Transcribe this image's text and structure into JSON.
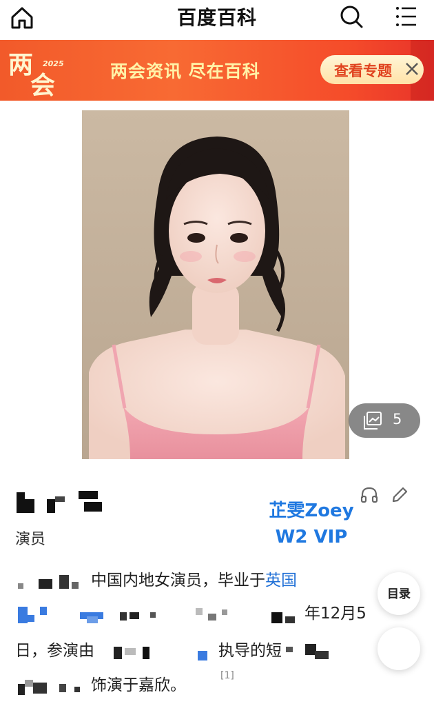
{
  "header": {
    "title": "百度百科",
    "home_icon": "home-icon",
    "search_icon": "search-icon",
    "menu_icon": "menu-icon"
  },
  "banner": {
    "logo_text": "两会",
    "logo_year": "2025",
    "slogan": "两会资讯 尽在百科",
    "cta_label": "查看专题",
    "close_icon": "close-icon",
    "colors": {
      "background": "#f25a2a",
      "slogan": "#fff3a8",
      "cta_text": "#e0431f"
    }
  },
  "photo": {
    "gallery_icon": "gallery-icon",
    "gallery_count": "5"
  },
  "entry": {
    "role": "演员",
    "audio_icon": "headphones-icon",
    "edit_icon": "pencil-icon",
    "watermark_line1": "芷雯Zoey",
    "watermark_line2": "W2 VIP",
    "watermark_color": "#1f78e0"
  },
  "summary": {
    "line1_text": "中国内地女演员，毕业于",
    "line1_link": "英国",
    "line2_text": "年12月5",
    "line3_start": "日，参演由",
    "line3_end": "执导的短",
    "line4_text": "饰演于嘉欣。",
    "footnote": "[1]",
    "link_color": "#1f6fd6"
  },
  "floating": {
    "catalog_label": "目录"
  }
}
